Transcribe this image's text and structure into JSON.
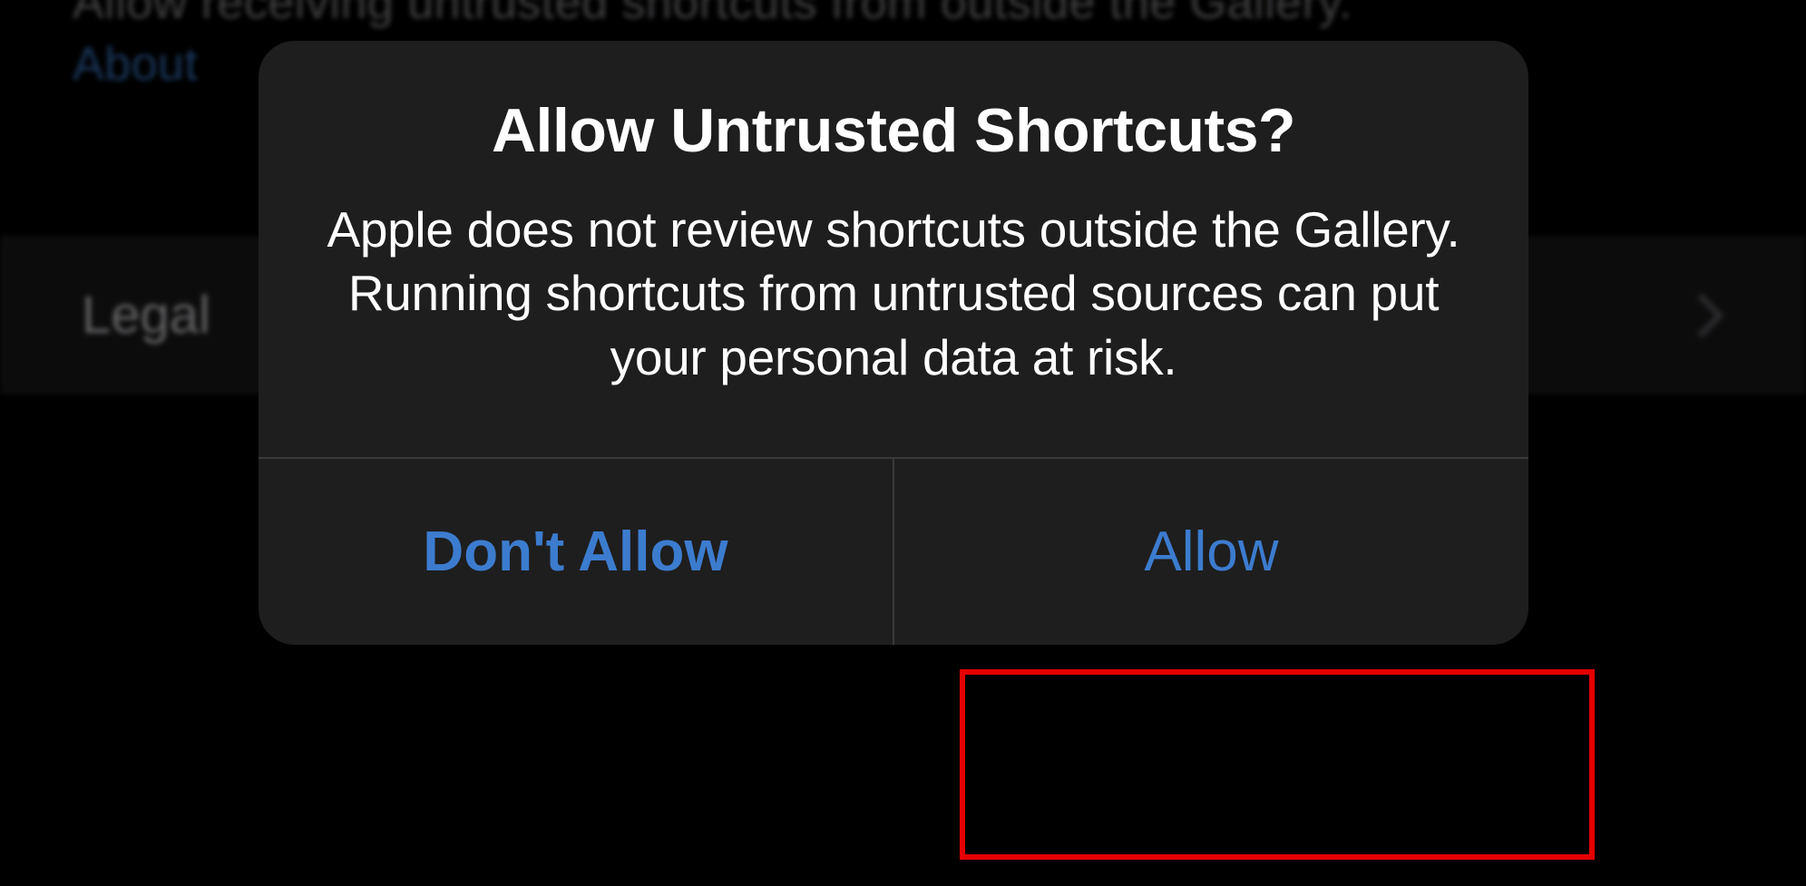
{
  "background": {
    "description_line": "Allow receiving untrusted shortcuts from outside the Gallery.",
    "about_link_prefix": "About ",
    "legal_row_label": "Legal"
  },
  "dialog": {
    "title": "Allow Untrusted Shortcuts?",
    "message": "Apple does not review shortcuts outside the Gallery. Running shortcuts from untrusted sources can put your personal data at risk.",
    "deny_label": "Don't Allow",
    "allow_label": "Allow"
  },
  "colors": {
    "accent": "#3c7ccf",
    "highlight": "#e40000",
    "dialog_bg": "#1e1e1e",
    "page_bg": "#000000"
  }
}
